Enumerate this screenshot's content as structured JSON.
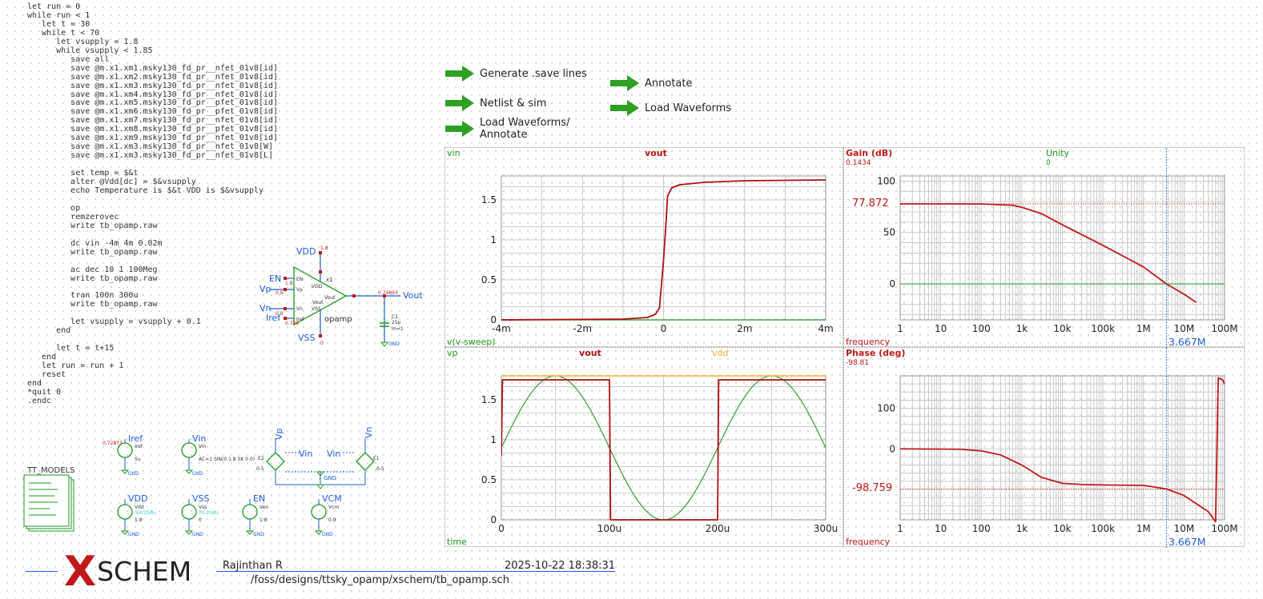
{
  "netlist_code": "let run = 0\nwhile run < 1\n   let t = 30\n   while t < 70\n      let vsupply = 1.8\n      while vsupply < 1.85\n         save all\n         save @m.x1.xm1.msky130_fd_pr__nfet_01v8[id]\n         save @m.x1.xm2.msky130_fd_pr__nfet_01v8[id]\n         save @m.x1.xm3.msky130_fd_pr__nfet_01v8[id]\n         save @m.x1.xm4.msky130_fd_pr__nfet_01v8[id]\n         save @m.x1.xm5.msky130_fd_pr__pfet_01v8[id]\n         save @m.x1.xm6.msky130_fd_pr__pfet_01v8[id]\n         save @m.x1.xm7.msky130_fd_pr__nfet_01v8[id]\n         save @m.x1.xm8.msky130_fd_pr__pfet_01v8[id]\n         save @m.x1.xm9.msky130_fd_pr__nfet_01v8[id]\n         save @m.x1.xm3.msky130_fd_pr__nfet_01v8[W]\n         save @m.x1.xm3.msky130_fd_pr__nfet_01v8[L]\n\n         set temp = $&t\n         alter @Vdd[dc] = $&vsupply\n         echo Temperature is $&t VDD is $&vsupply\n\n         op\n         remzerovec\n         write tb_opamp.raw\n\n         dc vin -4m 4m 0.02m\n         write tb_opamp.raw\n\n         ac dec 10 1 100Meg\n         write tb_opamp.raw\n\n         tran 100n 300u\n         write tb_opamp.raw\n\n         let vsupply = vsupply + 0.1\n      end\n\n      let t = t+15\n   end\n   let run = run + 1\n   reset\nend\n*quit 0\n.endc",
  "buttons": {
    "generate_save": "Generate .save lines",
    "netlist_sim": "Netlist & sim",
    "load_annotate_1": "Load Waveforms/",
    "load_annotate_2": "Annotate",
    "annotate": "Annotate",
    "load_waveforms": "Load Waveforms"
  },
  "colors": {
    "arrow": "#2ea024",
    "wire": "#1a5fd6",
    "red": "#c01818",
    "green": "#1e9a1e",
    "dc_red": "#b01010",
    "orange": "#f0b429",
    "cursor": "#1a5fd6",
    "grid": "#c0c0c0"
  },
  "schematic": {
    "vdd": "VDD",
    "vss": "VSS",
    "en": "EN",
    "vp": "Vp",
    "vn": "Vn",
    "iref": "Iref",
    "vout": "Vout",
    "inst": "x1",
    "symbol": "opamp",
    "pin_en": "EN",
    "pin_vdd": "VDD",
    "pin_vp": "Vp",
    "pin_vn": "Vn",
    "pin_vss": "VSS",
    "pin_out": "Vout",
    "pin_iref": "Iref",
    "c1": "C1",
    "c1_val": "25p",
    "c1_m": "m=1",
    "vout_ann": "0.74893",
    "ann_vdd": "1.8",
    "ann_en": "1.8",
    "ann_vp": "0.9",
    "ann_vn": "0.9",
    "ann_iref": "0.728",
    "ann_vss": "0",
    "gnd": "GND",
    "tt_models": "TT_MODELS",
    "iref_src": "Iref",
    "iref_ann": "0.72873",
    "iref_val": "5u",
    "iref_name": "Iref",
    "vin_src": "Vin",
    "vin_name": "Vin",
    "vin_val": "AC=1 SIN(0 1.8 5K 0 0)",
    "e2": "E2",
    "e1": "E1",
    "e_gain_neg": "0.5",
    "e_gain_pos": "-0.5",
    "e_vp": "Vp",
    "e_vn": "Vn",
    "e_vin1": "Vin",
    "e_vin2": "Vin",
    "vcm_small": "VCM",
    "vdd_src": "VDD",
    "vdd_name": "Vdd",
    "vdd_val": "1.8",
    "vdd_i": "-60.258u",
    "vss_src": "VSS",
    "vss_name": "Vss",
    "vss_val": "0",
    "vss_i": "70.258u",
    "en_src": "EN",
    "en_name": "Ven",
    "en_val": "1.8",
    "vcm_src": "VCM",
    "vcm_name": "Vcm",
    "vcm_val": "0.9"
  },
  "plots": {
    "dc": {
      "sig_left": "vin",
      "sig_center": "vout",
      "xlabel": "v(v-sweep)"
    },
    "gain": {
      "title": "Gain (dB)",
      "value": "0.1434",
      "sig2": "Unity",
      "sig2_value": "0",
      "cursor_y": "77.872",
      "xlabel": "frequency",
      "cursor_x": "3.667M"
    },
    "tran": {
      "sig1": "vp",
      "sig2": "vout",
      "sig3": "vdd",
      "xlabel": "time"
    },
    "phase": {
      "title": "Phase (deg)",
      "value": "-98.81",
      "cursor_y": "-98.759",
      "xlabel": "frequency",
      "cursor_x": "3.667M"
    }
  },
  "chart_data": [
    {
      "type": "line",
      "title": "",
      "xlabel": "v(v-sweep)",
      "xlim": [
        -0.004,
        0.004
      ],
      "ylim": [
        0,
        1.8
      ],
      "xticks": [
        "-4m",
        "-2m",
        "0",
        "2m",
        "4m"
      ],
      "yticks": [
        "0",
        "0.5",
        "1",
        "1.5"
      ],
      "series": [
        {
          "name": "vin",
          "values_x": [
            -0.004,
            0.004
          ],
          "values_y": [
            0,
            0
          ]
        },
        {
          "name": "vout",
          "values_x": [
            -0.004,
            -0.001,
            -0.0004,
            -0.0002,
            -0.0001,
            0,
            6e-05,
            0.0001,
            0.0002,
            0.0004,
            0.001,
            0.002,
            0.004
          ],
          "values_y": [
            0.0,
            0.01,
            0.03,
            0.07,
            0.15,
            0.75,
            1.2,
            1.55,
            1.65,
            1.69,
            1.72,
            1.74,
            1.75
          ]
        }
      ]
    },
    {
      "type": "line",
      "title": "Gain (dB)",
      "xlabel": "frequency",
      "xscale": "log",
      "xlim": [
        1,
        100000000
      ],
      "ylim": [
        -35,
        105
      ],
      "xticks": [
        "1",
        "10",
        "100",
        "1k",
        "10k",
        "100k",
        "1M",
        "10M",
        "100M"
      ],
      "yticks": [
        "0",
        "50",
        "100"
      ],
      "series": [
        {
          "name": "Gain (dB)",
          "values_x": [
            1,
            100,
            600,
            1000,
            3000,
            10000,
            100000,
            1000000,
            3667000,
            10000000,
            20000000
          ],
          "values_y": [
            77.87,
            77.8,
            76.5,
            74.5,
            68.5,
            57.5,
            37.5,
            16.5,
            0,
            -10,
            -18
          ]
        },
        {
          "name": "Unity",
          "values_x": [
            1,
            100000000
          ],
          "values_y": [
            0,
            0
          ]
        }
      ]
    },
    {
      "type": "line",
      "title": "",
      "xlabel": "time",
      "xlim": [
        0,
        0.0003
      ],
      "ylim": [
        0,
        1.8
      ],
      "xticks": [
        "0",
        "100u",
        "200u",
        "300u"
      ],
      "yticks": [
        "0",
        "0.5",
        "1",
        "1.5"
      ],
      "series": [
        {
          "name": "vp",
          "values_x": [
            0,
            5e-05,
            0.0001,
            0.00015,
            0.0002,
            0.00025,
            0.0003
          ],
          "values_y": [
            0.9,
            1.8,
            0.9,
            0,
            0.9,
            1.8,
            0.9
          ]
        },
        {
          "name": "vout",
          "values_x": [
            0,
            1e-06,
            0.0001,
            0.000101,
            0.0002,
            0.000201,
            0.0003
          ],
          "values_y": [
            0.8,
            1.75,
            1.75,
            0,
            0,
            1.75,
            1.75
          ]
        },
        {
          "name": "vdd",
          "values_x": [
            0,
            0.0003
          ],
          "values_y": [
            1.8,
            1.8
          ]
        }
      ]
    },
    {
      "type": "line",
      "title": "Phase (deg)",
      "xlabel": "frequency",
      "xscale": "log",
      "xlim": [
        1,
        100000000
      ],
      "ylim": [
        -175,
        180
      ],
      "xticks": [
        "1",
        "10",
        "100",
        "1k",
        "10k",
        "100k",
        "1M",
        "10M",
        "100M"
      ],
      "yticks": [
        "0",
        "100"
      ],
      "series": [
        {
          "name": "Phase (deg)",
          "values_x": [
            1,
            30,
            100,
            300,
            1000,
            3000,
            10000,
            30000,
            100000,
            1000000,
            3667000,
            10000000,
            40000000,
            60000000,
            70000000,
            90000000,
            100000000
          ],
          "values_y": [
            0,
            -1,
            -5,
            -15,
            -40,
            -70,
            -85,
            -88,
            -89,
            -90,
            -98.8,
            -115,
            -155,
            -180,
            175,
            170,
            160
          ]
        }
      ]
    }
  ],
  "title_block": {
    "author": "Rajinthan R",
    "date": "2025-10-22  18:38:31",
    "path": "/foss/designs/ttsky_opamp/xschem/tb_opamp.sch",
    "logo_x": "X",
    "logo_text": "SCHEM"
  }
}
